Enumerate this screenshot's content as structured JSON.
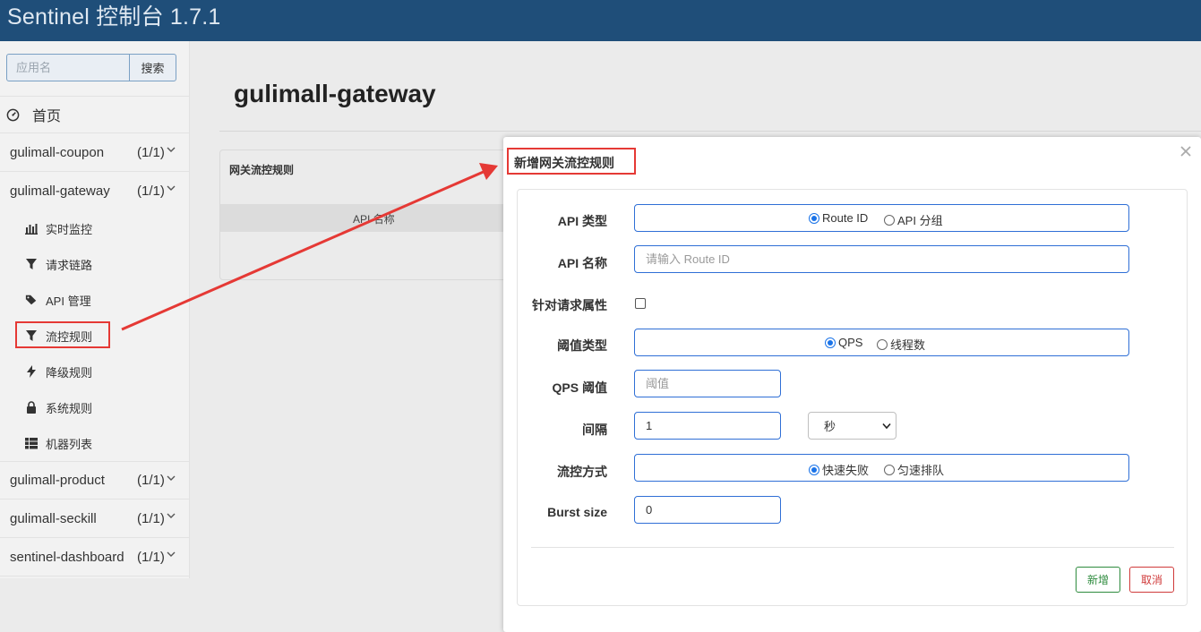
{
  "header": {
    "brand": "Sentinel 控制台 1.7.1"
  },
  "sidebar": {
    "search": {
      "placeholder": "应用名",
      "button_label": "搜索"
    },
    "home_label": "首页",
    "apps": [
      {
        "name": "gulimall-coupon",
        "count": "(1/1)"
      },
      {
        "name": "gulimall-gateway",
        "count": "(1/1)"
      },
      {
        "name": "gulimall-product",
        "count": "(1/1)"
      },
      {
        "name": "gulimall-seckill",
        "count": "(1/1)"
      },
      {
        "name": "sentinel-dashboard",
        "count": "(1/1)"
      }
    ],
    "gateway_menu": [
      {
        "label": "实时监控",
        "icon": "bar-chart-icon"
      },
      {
        "label": "请求链路",
        "icon": "filter-icon"
      },
      {
        "label": "API 管理",
        "icon": "tags-icon"
      },
      {
        "label": "流控规则",
        "icon": "filter-icon",
        "active": true
      },
      {
        "label": "降级规则",
        "icon": "bolt-icon"
      },
      {
        "label": "系统规则",
        "icon": "lock-icon"
      },
      {
        "label": "机器列表",
        "icon": "th-list-icon"
      }
    ]
  },
  "main": {
    "title": "gulimall-gateway",
    "card_title": "网关流控规则",
    "column_header": "API 名称"
  },
  "modal": {
    "title": "新增网关流控规则",
    "fields": {
      "api_type": {
        "label": "API 类型",
        "options": [
          "Route ID",
          "API 分组"
        ],
        "selected": "Route ID"
      },
      "api_name": {
        "label": "API 名称",
        "placeholder": "请输入 Route ID"
      },
      "request_attr": {
        "label": "针对请求属性",
        "checked": false
      },
      "threshold_type": {
        "label": "阈值类型",
        "options": [
          "QPS",
          "线程数"
        ],
        "selected": "QPS"
      },
      "qps_threshold": {
        "label": "QPS 阈值",
        "placeholder": "阈值"
      },
      "interval": {
        "label": "间隔",
        "value": "1",
        "unit": "秒"
      },
      "control_mode": {
        "label": "流控方式",
        "options": [
          "快速失败",
          "匀速排队"
        ],
        "selected": "快速失败"
      },
      "burst_size": {
        "label": "Burst size",
        "value": "0"
      }
    },
    "buttons": {
      "add": "新增",
      "cancel": "取消"
    }
  },
  "colors": {
    "topbar": "#1f4e79",
    "highlight": "#e53935",
    "primary": "#1a73e8",
    "success": "#2e8b3e",
    "danger": "#d03a3a"
  }
}
